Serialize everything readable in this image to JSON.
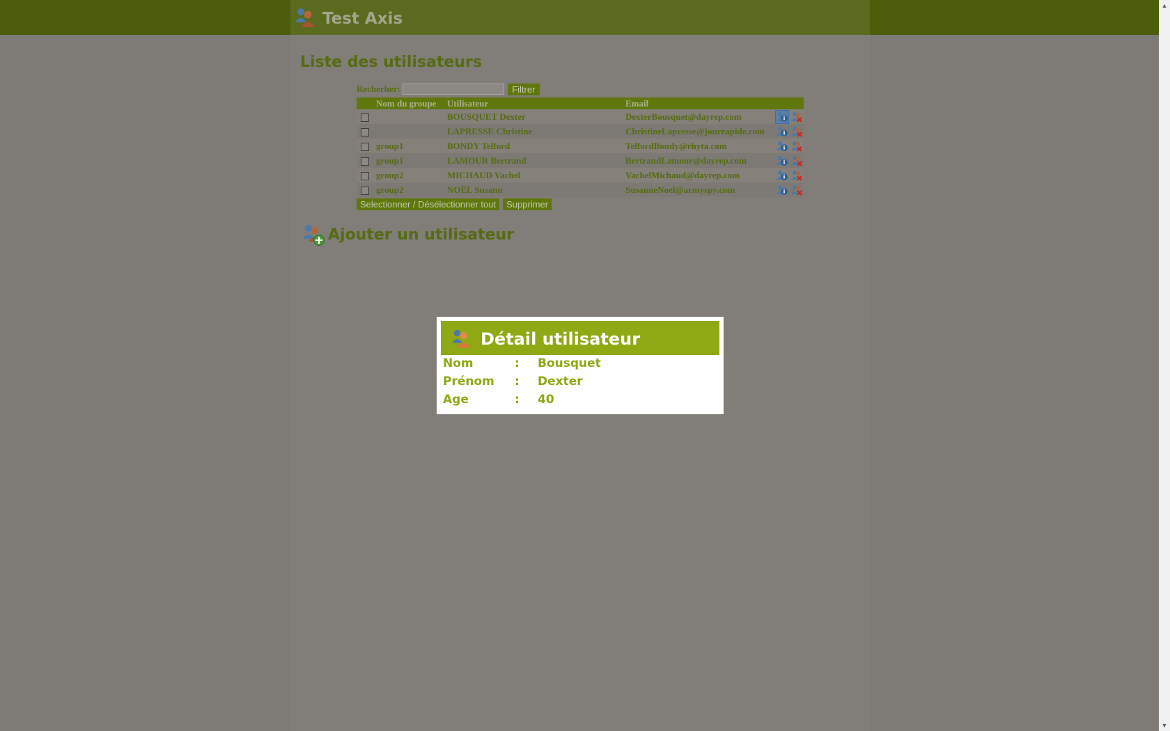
{
  "header": {
    "app_title": "Test Axis",
    "logo_icon": "users-icon"
  },
  "page": {
    "title": "Liste des utilisateurs"
  },
  "search": {
    "label": "Recherher:",
    "value": "",
    "filter_label": "Filtrer"
  },
  "table": {
    "headers": {
      "group": "Nom du groupe",
      "user": "Utilisateur",
      "email": "Email"
    },
    "rows": [
      {
        "group": "",
        "user": "BOUSQUET Dexter",
        "email": "DexterBousquet@dayrep.com"
      },
      {
        "group": "",
        "user": "LAPRESSE Christine",
        "email": "ChristineLapresse@jourrapide.com"
      },
      {
        "group": "group1",
        "user": "BONDY Telford",
        "email": "TelfordBondy@rhyta.com"
      },
      {
        "group": "group1",
        "user": "LAMOUR Bertrand",
        "email": "BertrandLamour@dayrep.com"
      },
      {
        "group": "group2",
        "user": "MICHAUD Vachel",
        "email": "VachelMichaud@dayrep.com"
      },
      {
        "group": "group2",
        "user": "NOËL Susann",
        "email": "SusanneNoel@armyspy.com"
      }
    ],
    "row_action_icons": [
      "user-info-icon",
      "delete-user-icon"
    ]
  },
  "actions": {
    "select_all_label": "Selectionner / Désélectionner tout",
    "delete_label": "Supprimer"
  },
  "add_user": {
    "label": "Ajouter un utilisateur",
    "icon": "add-user-icon"
  },
  "modal": {
    "title": "Détail utilisateur",
    "fields": [
      {
        "label": "Nom",
        "separator": ":",
        "value": "Bousquet"
      },
      {
        "label": "Prénom",
        "separator": ":",
        "value": "Dexter"
      },
      {
        "label": "Age",
        "separator": ":",
        "value": "40"
      }
    ]
  },
  "colors": {
    "header_bar": "#4b5c0a",
    "accent_green": "#556b12",
    "modal_header": "#8ea914",
    "overlay_background": "#7e7a75"
  }
}
